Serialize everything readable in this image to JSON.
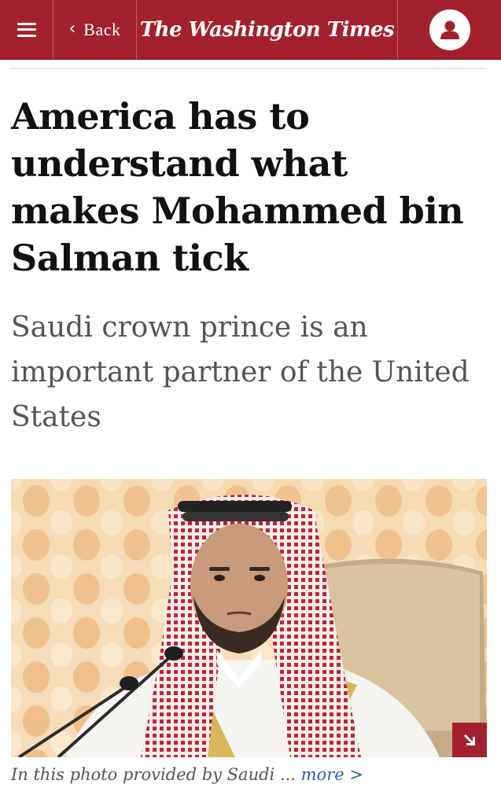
{
  "header": {
    "back_label": "Back",
    "back_icon": "chevron-left-icon",
    "menu_icon": "hamburger-menu-icon",
    "logo_text": "The Washington Times",
    "account_icon": "user-account-icon",
    "brand_color": "#a3212e"
  },
  "article": {
    "headline": "America has to understand what makes Mohammed bin Salman tick",
    "subheadline": "Saudi crown prince is an important partner of the United States"
  },
  "photo": {
    "expand_icon": "expand-arrow-icon",
    "caption_text": "In this photo provided by Saudi",
    "caption_ellipsis": " ... ",
    "caption_more": "more >"
  }
}
